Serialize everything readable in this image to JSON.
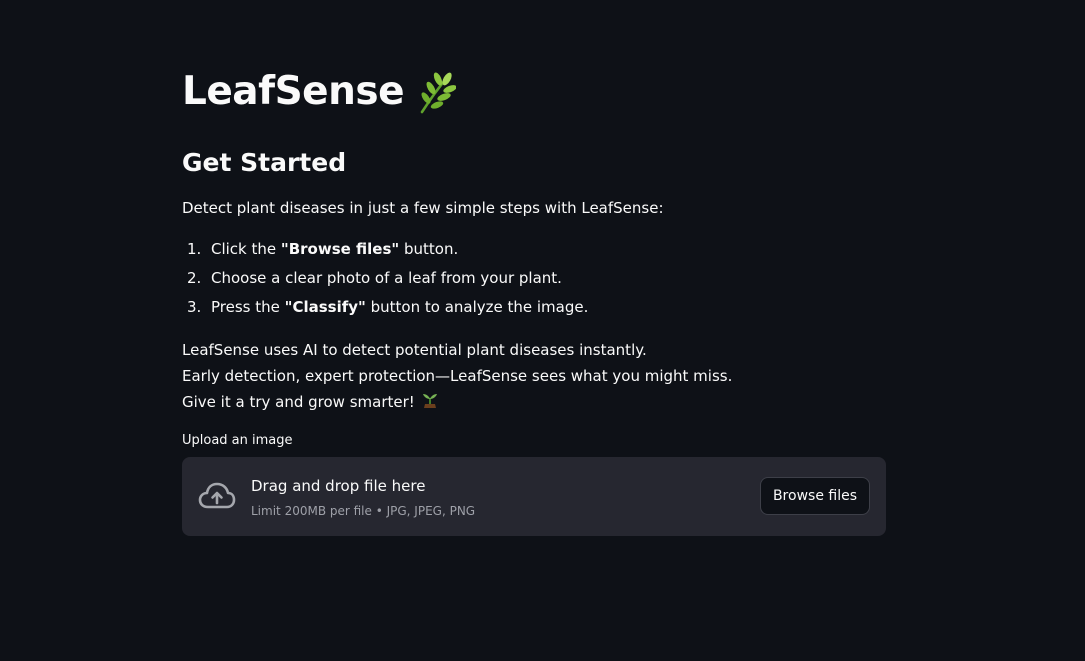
{
  "header": {
    "title": "LeafSense",
    "title_emoji": "herb-icon"
  },
  "main": {
    "subtitle": "Get Started",
    "intro": "Detect plant diseases in just a few simple steps with LeafSense:",
    "steps": [
      {
        "num": "1.",
        "before": "Click the ",
        "bold": "\"Browse files\"",
        "after": " button."
      },
      {
        "num": "2.",
        "before": "Choose a clear photo of a leaf from your plant.",
        "bold": "",
        "after": ""
      },
      {
        "num": "3.",
        "before": "Press the ",
        "bold": "\"Classify\"",
        "after": " button to analyze the image."
      }
    ],
    "about": [
      "LeafSense uses AI to detect potential plant diseases instantly.",
      "Early detection, expert protection—LeafSense sees what you might miss.",
      "Give it a try and grow smarter!"
    ],
    "about_emoji": "seedling-icon"
  },
  "uploader": {
    "label": "Upload an image",
    "drop_title": "Drag and drop file here",
    "drop_subtitle": "Limit 200MB per file • JPG, JPEG, PNG",
    "button_label": "Browse files",
    "icon": "cloud-upload-icon"
  },
  "colors": {
    "background": "#0e1117",
    "dropzone": "#262730",
    "text": "#fafafa",
    "muted_text": "#9ea0a8"
  }
}
